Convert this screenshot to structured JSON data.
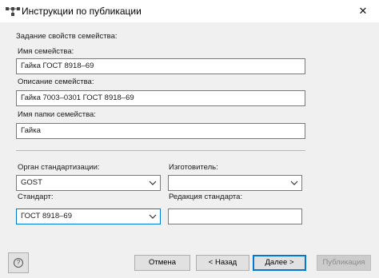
{
  "window": {
    "title": "Инструкции по публикации",
    "close_glyph": "✕"
  },
  "section": {
    "heading": "Задание свойств семейства:"
  },
  "family": {
    "name_label": "Имя семейства:",
    "name_value": "Гайка  ГОСТ 8918–69",
    "description_label": "Описание семейства:",
    "description_value": "Гайка 7003–0301 ГОСТ 8918–69",
    "folder_label": "Имя папки семейства:",
    "folder_value": "Гайка"
  },
  "standard": {
    "org_label": "Орган стандартизации:",
    "org_value": "GOST",
    "manufacturer_label": "Изготовитель:",
    "manufacturer_value": "",
    "standard_label": "Стандарт:",
    "standard_value": "ГОСТ 8918–69",
    "revision_label": "Редакция стандарта:",
    "revision_value": ""
  },
  "buttons": {
    "help": "?",
    "cancel": "Отмена",
    "back": "< Назад",
    "next": "Далее >",
    "publish": "Публикация"
  },
  "icons": {
    "app": "hierarchy-icon",
    "close": "close-icon",
    "dropdown": "chevron-down-icon",
    "help": "help-icon"
  },
  "colors": {
    "focus_border": "#0078d7",
    "dialog_bg": "#f0f0f0",
    "button_bg": "#e1e1e1"
  }
}
